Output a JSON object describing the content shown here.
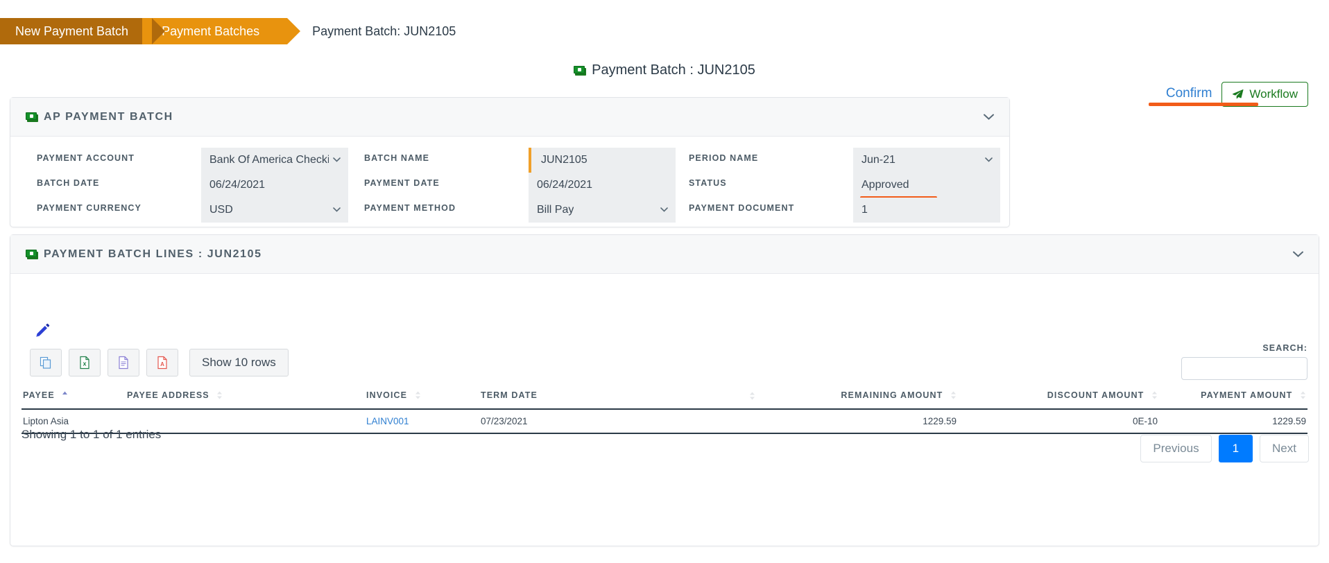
{
  "breadcrumb": {
    "items": [
      {
        "label": "New Payment Batch"
      },
      {
        "label": "Payment Batches"
      }
    ],
    "current": "Payment Batch: JUN2105"
  },
  "page_title": "Payment Batch : JUN2105",
  "actions": {
    "confirm_label": "Confirm",
    "workflow_label": "Workflow"
  },
  "ap_panel": {
    "title": "AP PAYMENT BATCH",
    "fields": [
      {
        "label": "PAYMENT ACCOUNT",
        "value": "Bank Of America Checkir",
        "type": "select"
      },
      {
        "label": "BATCH DATE",
        "value": "06/24/2021",
        "type": "text"
      },
      {
        "label": "PAYMENT CURRENCY",
        "value": "USD",
        "type": "select"
      },
      {
        "label": "BATCH NAME",
        "value": "JUN2105",
        "type": "text"
      },
      {
        "label": "PAYMENT DATE",
        "value": "06/24/2021",
        "type": "text"
      },
      {
        "label": "PAYMENT METHOD",
        "value": "Bill Pay",
        "type": "select"
      },
      {
        "label": "PERIOD NAME",
        "value": "Jun-21",
        "type": "select"
      },
      {
        "label": "STATUS",
        "value": "Approved",
        "type": "text"
      },
      {
        "label": "PAYMENT DOCUMENT",
        "value": "1",
        "type": "text"
      }
    ]
  },
  "lines_panel": {
    "title": "PAYMENT BATCH LINES : JUN2105",
    "toolbar": {
      "copy_icon": "copy-icon",
      "excel_icon": "excel-icon",
      "csv_icon": "csv-document-icon",
      "pdf_icon": "pdf-icon",
      "rows_label": "Show 10 rows",
      "edit_icon": "pencil-icon"
    },
    "search": {
      "label": "SEARCH:",
      "value": "",
      "placeholder": ""
    },
    "table": {
      "columns": [
        {
          "label": "PAYEE",
          "align": "left",
          "sort": "asc"
        },
        {
          "label": "PAYEE ADDRESS",
          "align": "left",
          "sort": "none"
        },
        {
          "label": "INVOICE",
          "align": "left",
          "sort": "none"
        },
        {
          "label": "TERM DATE",
          "align": "left",
          "sort": "none"
        },
        {
          "label": "REMAINING AMOUNT",
          "align": "right",
          "sort": "none"
        },
        {
          "label": "DISCOUNT AMOUNT",
          "align": "right",
          "sort": "none"
        },
        {
          "label": "PAYMENT AMOUNT",
          "align": "right",
          "sort": "none"
        }
      ],
      "rows": [
        {
          "payee": "Lipton Asia",
          "payee_address": "",
          "invoice": "LAINV001",
          "term_date": "07/23/2021",
          "remaining_amount": "1229.59",
          "discount_amount": "0E-10",
          "payment_amount": "1229.59"
        }
      ]
    },
    "footer": {
      "info": "Showing 1 to 1 of 1 entries",
      "previous_label": "Previous",
      "page_label": "1",
      "next_label": "Next"
    }
  },
  "colors": {
    "crumb_dark": "#b06a0c",
    "crumb_light": "#e8930e",
    "accent_orange": "#f25c19",
    "link_blue": "#2f7fd1",
    "active_page_blue": "#007bff",
    "workflow_green": "#1a7a1f"
  }
}
